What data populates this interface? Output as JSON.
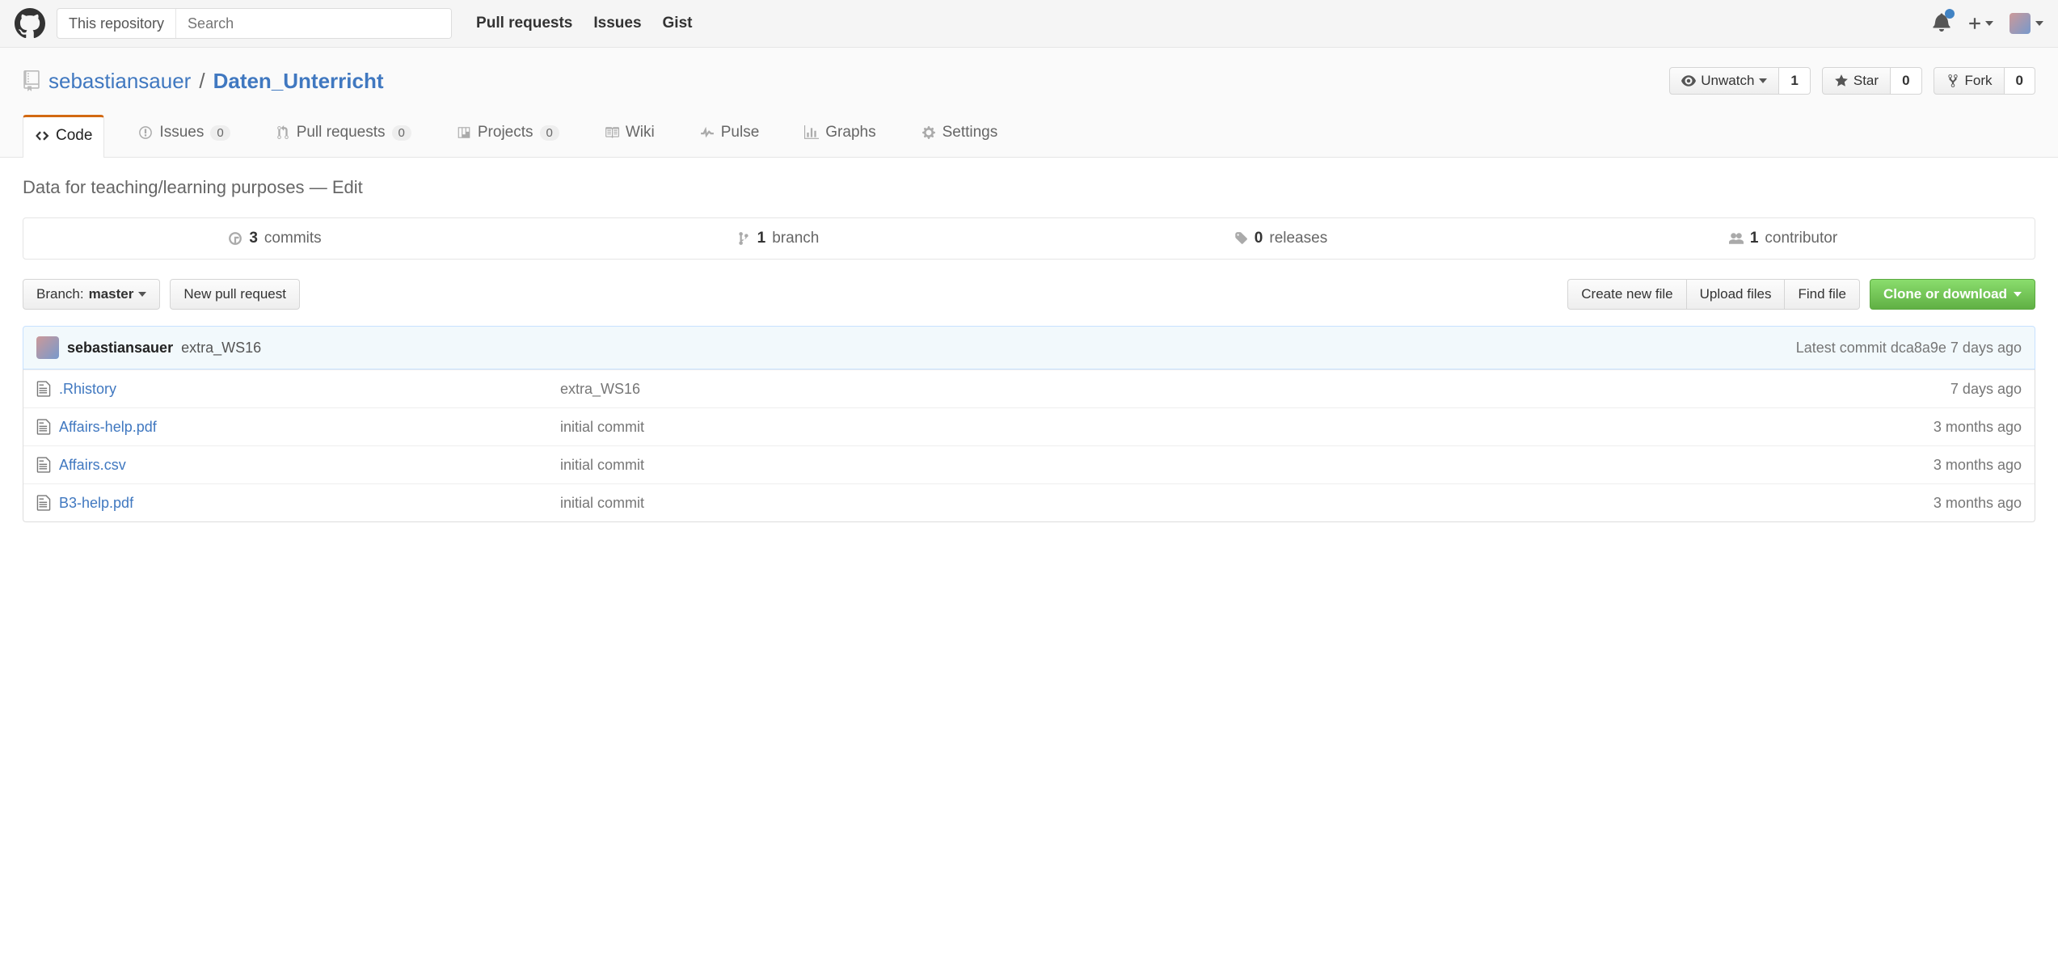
{
  "topbar": {
    "search_scope": "This repository",
    "search_placeholder": "Search",
    "nav": {
      "pulls": "Pull requests",
      "issues": "Issues",
      "gist": "Gist"
    }
  },
  "repo": {
    "owner": "sebastiansauer",
    "sep": "/",
    "name": "Daten_Unterricht",
    "actions": {
      "watch_label": "Unwatch",
      "watch_count": "1",
      "star_label": "Star",
      "star_count": "0",
      "fork_label": "Fork",
      "fork_count": "0"
    }
  },
  "tabs": {
    "code": "Code",
    "issues": "Issues",
    "issues_count": "0",
    "pulls": "Pull requests",
    "pulls_count": "0",
    "projects": "Projects",
    "projects_count": "0",
    "wiki": "Wiki",
    "pulse": "Pulse",
    "graphs": "Graphs",
    "settings": "Settings"
  },
  "description": {
    "text": "Data for teaching/learning purposes",
    "dash": "—",
    "edit": "Edit"
  },
  "stats": {
    "commits_n": "3",
    "commits_l": "commits",
    "branches_n": "1",
    "branches_l": "branch",
    "releases_n": "0",
    "releases_l": "releases",
    "contrib_n": "1",
    "contrib_l": "contributor"
  },
  "filebar": {
    "branch_prefix": "Branch:",
    "branch_name": "master",
    "new_pr": "New pull request",
    "create": "Create new file",
    "upload": "Upload files",
    "find": "Find file",
    "clone": "Clone or download"
  },
  "commit_tease": {
    "author": "sebastiansauer",
    "message": "extra_WS16",
    "latest_label": "Latest commit",
    "sha": "dca8a9e",
    "time": "7 days ago"
  },
  "files": [
    {
      "name": ".Rhistory",
      "msg": "extra_WS16",
      "date": "7 days ago"
    },
    {
      "name": "Affairs-help.pdf",
      "msg": "initial commit",
      "date": "3 months ago"
    },
    {
      "name": "Affairs.csv",
      "msg": "initial commit",
      "date": "3 months ago"
    },
    {
      "name": "B3-help.pdf",
      "msg": "initial commit",
      "date": "3 months ago"
    }
  ]
}
